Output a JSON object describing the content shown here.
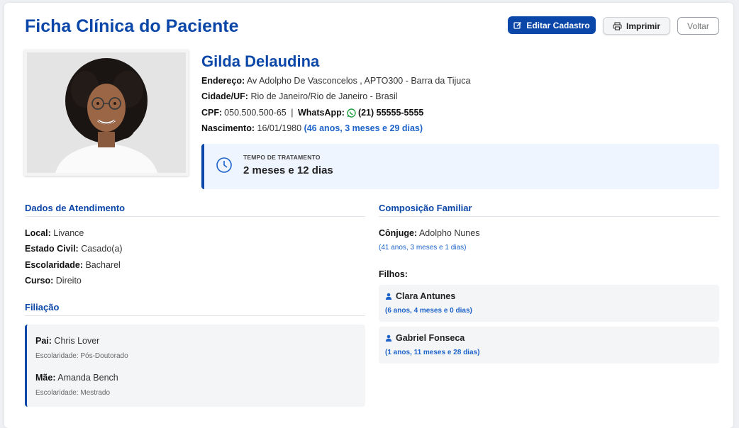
{
  "header": {
    "title": "Ficha Clínica do Paciente",
    "edit_label": "Editar Cadastro",
    "print_label": "Imprimir",
    "back_label": "Voltar"
  },
  "patient": {
    "name": "Gilda Delaudina",
    "address_label": "Endereço:",
    "address": "Av Adolpho De Vasconcelos , APTO300 - Barra da Tijuca",
    "city_label": "Cidade/UF:",
    "city": "Rio de Janeiro/Rio de Janeiro - Brasil",
    "cpf_label": "CPF:",
    "cpf": "050.500.500-65",
    "separator": " | ",
    "whatsapp_label": "WhatsApp:",
    "whatsapp": "(21) 55555-5555",
    "birth_label": "Nascimento:",
    "birth": "16/01/1980",
    "age": "(46 anos, 3 meses e 29 dias)"
  },
  "treatment": {
    "label": "TEMPO DE TRATAMENTO",
    "value": "2 meses e 12 dias"
  },
  "attendance": {
    "title": "Dados de Atendimento",
    "local_label": "Local:",
    "local": "Livance",
    "civil_label": "Estado Civil:",
    "civil": "Casado(a)",
    "school_label": "Escolaridade:",
    "school": "Bacharel",
    "course_label": "Curso:",
    "course": "Direito"
  },
  "filiation": {
    "title": "Filiação",
    "father_label": "Pai:",
    "father": "Chris Lover",
    "father_school": "Escolaridade: Pós-Doutorado",
    "mother_label": "Mãe:",
    "mother": "Amanda Bench",
    "mother_school": "Escolaridade: Mestrado"
  },
  "family": {
    "title": "Composição Familiar",
    "spouse_label": "Cônjuge:",
    "spouse": "Adolpho Nunes",
    "spouse_age": "(41 anos, 3 meses e 1 dias)",
    "children_label": "Filhos:",
    "children": [
      {
        "name": "Clara Antunes",
        "age": "(6 anos, 4 meses e 0 dias)"
      },
      {
        "name": "Gabriel Fonseca",
        "age": "(1 anos, 11 meses e 28 dias)"
      }
    ]
  },
  "colors": {
    "primary": "#0b47a8",
    "link": "#1d63c9",
    "whatsapp": "#25a244"
  }
}
